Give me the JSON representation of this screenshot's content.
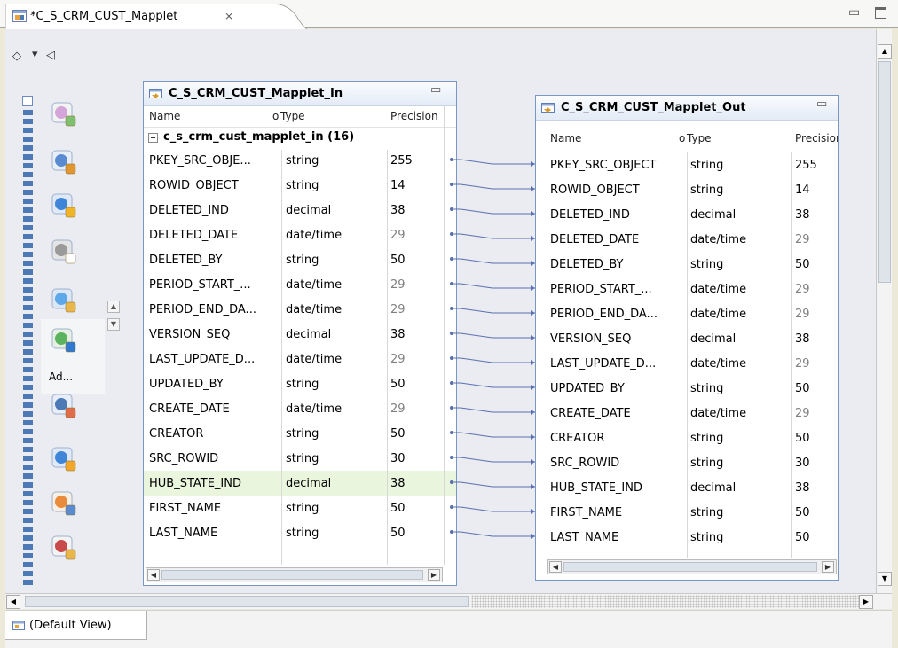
{
  "editor": {
    "tab_title": "*C_S_CRM_CUST_Mapplet",
    "close_glyph": "⨯",
    "minimize_glyph": "▭",
    "maximize_glyph": ""
  },
  "palette": {
    "toolbar": {
      "select_glyph": "◇",
      "dropdown_glyph": "▾",
      "collapse_glyph": "◁"
    },
    "selected_label": "Ad...",
    "icons": [
      "expression-transform-icon",
      "aggregator-transform-icon",
      "lookup-globe-icon",
      "sql-transform-icon",
      "web-service-icon",
      "address-validator-icon",
      "router-transform-icon",
      "update-strategy-icon",
      "sorter-transform-icon",
      "key-generator-icon"
    ],
    "scroll_up_glyph": "▲",
    "scroll_down_glyph": "▼"
  },
  "input_table": {
    "title": "C_S_CRM_CUST_Mapplet_In",
    "col_name": "Name",
    "col_type": "Type",
    "col_precision": "Precision",
    "col_marker": "o",
    "group_label": "c_s_crm_cust_mapplet_in (16)",
    "rows": [
      {
        "name": "PKEY_SRC_OBJE...",
        "type": "string",
        "precision": "255"
      },
      {
        "name": "ROWID_OBJECT",
        "type": "string",
        "precision": "14"
      },
      {
        "name": "DELETED_IND",
        "type": "decimal",
        "precision": "38"
      },
      {
        "name": "DELETED_DATE",
        "type": "date/time",
        "precision": "29"
      },
      {
        "name": "DELETED_BY",
        "type": "string",
        "precision": "50"
      },
      {
        "name": "PERIOD_START_...",
        "type": "date/time",
        "precision": "29"
      },
      {
        "name": "PERIOD_END_DA...",
        "type": "date/time",
        "precision": "29"
      },
      {
        "name": "VERSION_SEQ",
        "type": "decimal",
        "precision": "38"
      },
      {
        "name": "LAST_UPDATE_D...",
        "type": "date/time",
        "precision": "29"
      },
      {
        "name": "UPDATED_BY",
        "type": "string",
        "precision": "50"
      },
      {
        "name": "CREATE_DATE",
        "type": "date/time",
        "precision": "29"
      },
      {
        "name": "CREATOR",
        "type": "string",
        "precision": "50"
      },
      {
        "name": "SRC_ROWID",
        "type": "string",
        "precision": "30"
      },
      {
        "name": "HUB_STATE_IND",
        "type": "decimal",
        "precision": "38"
      },
      {
        "name": "FIRST_NAME",
        "type": "string",
        "precision": "50"
      },
      {
        "name": "LAST_NAME",
        "type": "string",
        "precision": "50"
      }
    ]
  },
  "output_table": {
    "title": "C_S_CRM_CUST_Mapplet_Out",
    "col_name": "Name",
    "col_type": "Type",
    "col_precision": "Precision",
    "col_marker": "o",
    "rows": [
      {
        "name": "PKEY_SRC_OBJECT",
        "type": "string",
        "precision": "255"
      },
      {
        "name": "ROWID_OBJECT",
        "type": "string",
        "precision": "14"
      },
      {
        "name": "DELETED_IND",
        "type": "decimal",
        "precision": "38"
      },
      {
        "name": "DELETED_DATE",
        "type": "date/time",
        "precision": "29"
      },
      {
        "name": "DELETED_BY",
        "type": "string",
        "precision": "50"
      },
      {
        "name": "PERIOD_START_...",
        "type": "date/time",
        "precision": "29"
      },
      {
        "name": "PERIOD_END_DA...",
        "type": "date/time",
        "precision": "29"
      },
      {
        "name": "VERSION_SEQ",
        "type": "decimal",
        "precision": "38"
      },
      {
        "name": "LAST_UPDATE_D...",
        "type": "date/time",
        "precision": "29"
      },
      {
        "name": "UPDATED_BY",
        "type": "string",
        "precision": "50"
      },
      {
        "name": "CREATE_DATE",
        "type": "date/time",
        "precision": "29"
      },
      {
        "name": "CREATOR",
        "type": "string",
        "precision": "50"
      },
      {
        "name": "SRC_ROWID",
        "type": "string",
        "precision": "30"
      },
      {
        "name": "HUB_STATE_IND",
        "type": "decimal",
        "precision": "38"
      },
      {
        "name": "FIRST_NAME",
        "type": "string",
        "precision": "50"
      },
      {
        "name": "LAST_NAME",
        "type": "string",
        "precision": "50"
      }
    ]
  },
  "scroll_glyphs": {
    "left": "◀",
    "right": "▶",
    "up": "▲",
    "down": "▼"
  },
  "bottom_view": {
    "label": "(Default View)"
  },
  "colors": {
    "accent": "#7897c3",
    "link_line": "#5a6fb0",
    "highlight_row": "#eaf5dd",
    "canvas": "#eaecf1"
  }
}
